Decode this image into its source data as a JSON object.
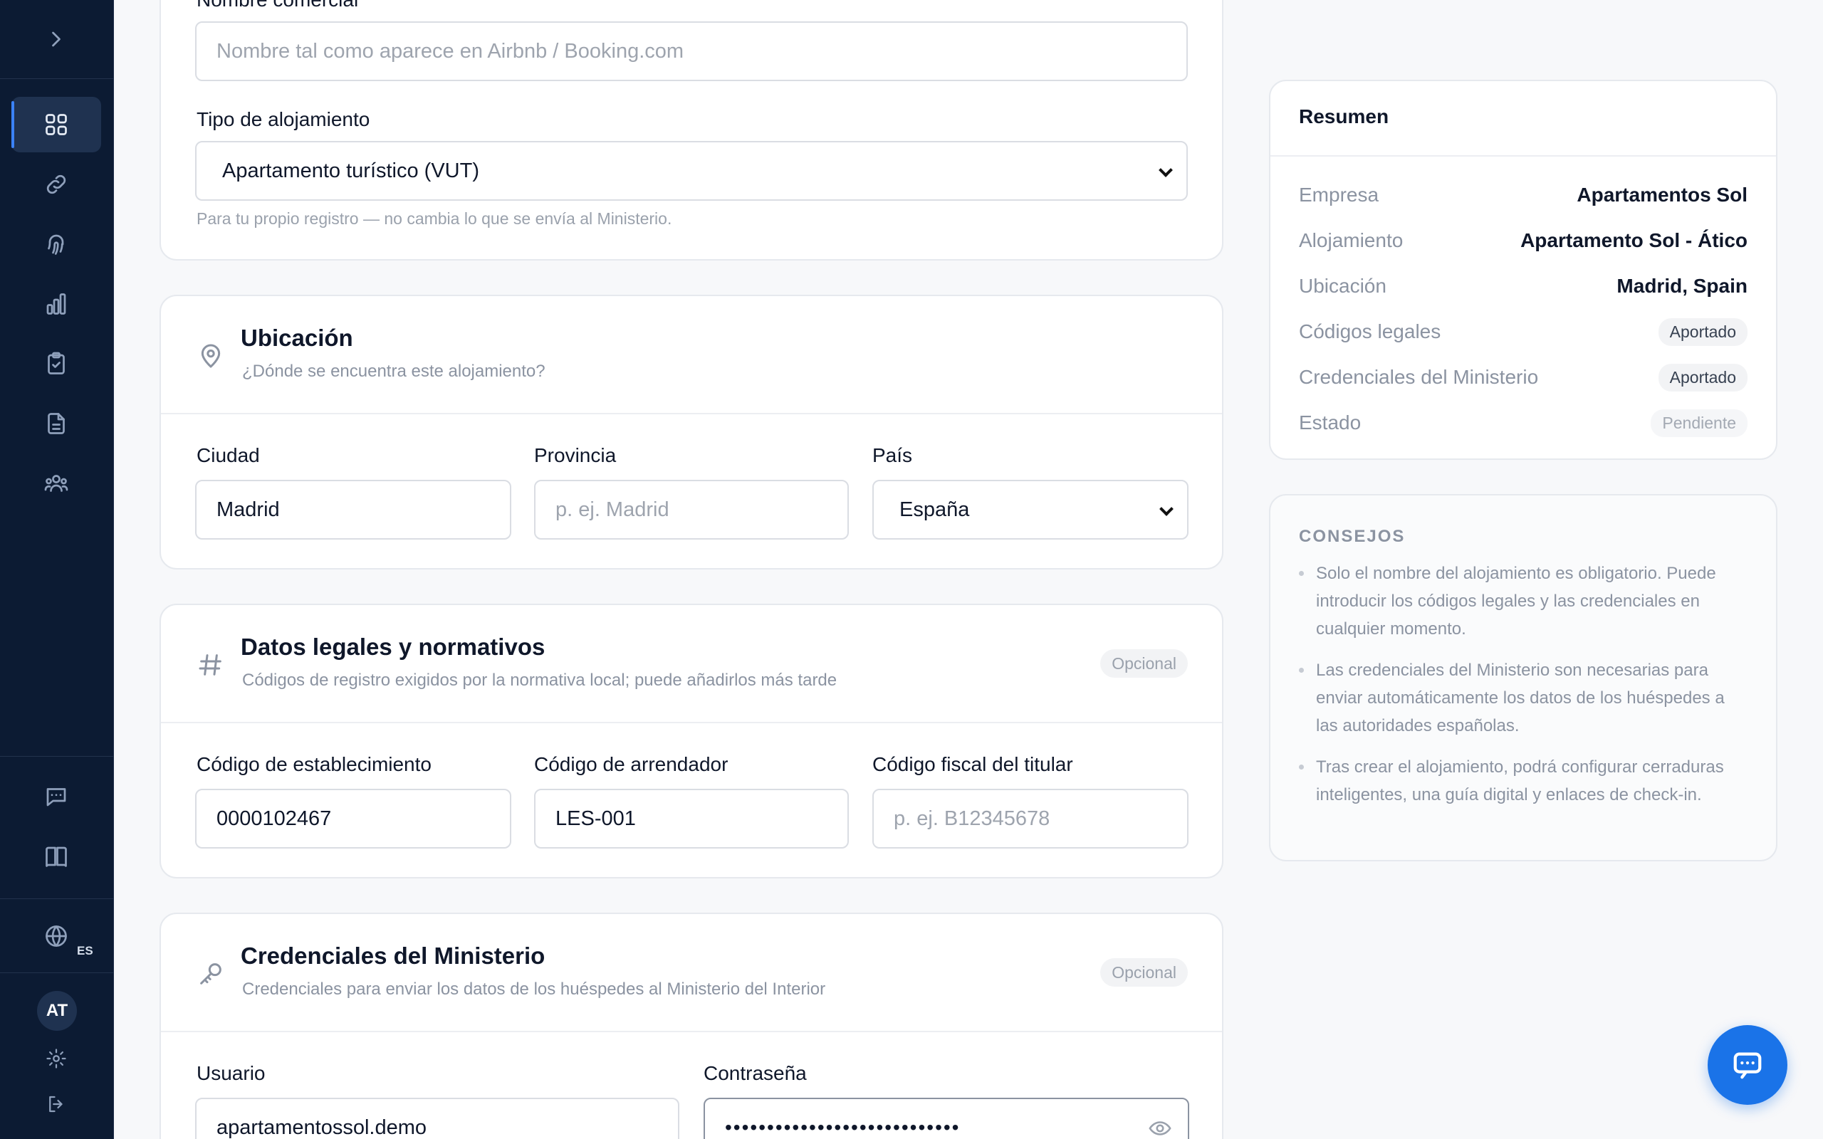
{
  "user": {
    "initials": "AT"
  },
  "language": {
    "code": "ES"
  },
  "general": {
    "name_label": "Nombre comercial",
    "name_placeholder": "Nombre tal como aparece en Airbnb / Booking.com",
    "type_label": "Tipo de alojamiento",
    "type_value": "Apartamento turístico (VUT)",
    "type_hint": "Para tu propio registro — no cambia lo que se envía al Ministerio."
  },
  "location": {
    "title": "Ubicación",
    "subtitle": "¿Dónde se encuentra este alojamiento?",
    "city_label": "Ciudad",
    "city_value": "Madrid",
    "province_label": "Provincia",
    "province_placeholder": "p. ej. Madrid",
    "country_label": "País",
    "country_value": "España"
  },
  "legal": {
    "title": "Datos legales y normativos",
    "subtitle": "Códigos de registro exigidos por la normativa local; puede añadirlos más tarde",
    "badge": "Opcional",
    "establishment_label": "Código de establecimiento",
    "establishment_value": "0000102467",
    "landlord_label": "Código de arrendador",
    "landlord_value": "LES-001",
    "tax_label": "Código fiscal del titular",
    "tax_placeholder": "p. ej. B12345678"
  },
  "ministry": {
    "title": "Credenciales del Ministerio",
    "subtitle": "Credenciales para enviar los datos de los huéspedes al Ministerio del Interior",
    "badge": "Opcional",
    "user_label": "Usuario",
    "user_value": "apartamentossol.demo",
    "password_label": "Contraseña",
    "password_value": "••••••••••••••••••••••••••••"
  },
  "summary": {
    "title": "Resumen",
    "rows": [
      {
        "key": "Empresa",
        "value": "Apartamentos Sol"
      },
      {
        "key": "Alojamiento",
        "value": "Apartamento Sol - Ático"
      },
      {
        "key": "Ubicación",
        "value": "Madrid, Spain"
      },
      {
        "key": "Códigos legales",
        "value": "Aportado"
      },
      {
        "key": "Credenciales del Ministerio",
        "value": "Aportado"
      },
      {
        "key": "Estado",
        "value": "Pendiente"
      }
    ]
  },
  "tips": {
    "title": "CONSEJOS",
    "items": [
      "Solo el nombre del alojamiento es obligatorio. Puede introducir los códigos legales y las credenciales en cualquier momento.",
      "Las credenciales del Ministerio son necesarias para enviar automáticamente los datos de los huéspedes a las autoridades españolas.",
      "Tras crear el alojamiento, podrá configurar cerraduras inteligentes, una guía digital y enlaces de check-in."
    ]
  },
  "icons": {
    "sidebar": [
      "chevron-right-icon",
      "dashboard-grid-icon",
      "link-icon",
      "fingerprint-icon",
      "bar-chart-icon",
      "clipboard-check-icon",
      "document-icon",
      "users-icon",
      "chat-icon",
      "book-icon",
      "globe-icon",
      "settings-icon",
      "logout-icon"
    ],
    "sections": [
      "map-pin-icon",
      "hash-icon",
      "key-icon"
    ]
  },
  "colors": {
    "sidebar_bg": "#0c1b33",
    "accent": "#1a73e8",
    "active_indicator": "#3b82f6"
  }
}
